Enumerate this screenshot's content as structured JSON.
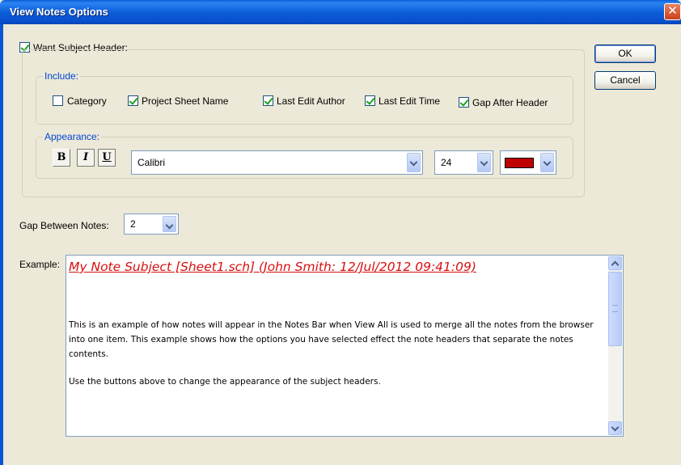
{
  "window": {
    "title": "View Notes Options",
    "close_glyph": "✕"
  },
  "subject_header": {
    "label": "Want Subject Header:",
    "checked": true
  },
  "include": {
    "title": "Include:",
    "category": "Category",
    "project_sheet_name": "Project Sheet Name",
    "last_edit_author": "Last Edit Author",
    "last_edit_time": "Last Edit Time",
    "gap_after_header": "Gap After Header"
  },
  "appearance": {
    "title": "Appearance:",
    "bold": "B",
    "italic": "I",
    "underline": "U",
    "font": "Calibri",
    "size": "24",
    "color": "#c00000"
  },
  "gap_between_notes": {
    "label": "Gap Between Notes:",
    "value": "2"
  },
  "buttons": {
    "ok": "OK",
    "cancel": "Cancel"
  },
  "example": {
    "label": "Example:",
    "header": "My Note Subject  [Sheet1.sch]    (John Smith: 12/Jul/2012 09:41:09)",
    "paragraph1": "This is an example of how notes will appear in the Notes Bar when View All is used to merge all the notes from the browser into one item. This example shows how the options you have selected effect the note headers that separate the notes contents.",
    "paragraph2": "Use the buttons above to change the appearance of the subject headers."
  }
}
